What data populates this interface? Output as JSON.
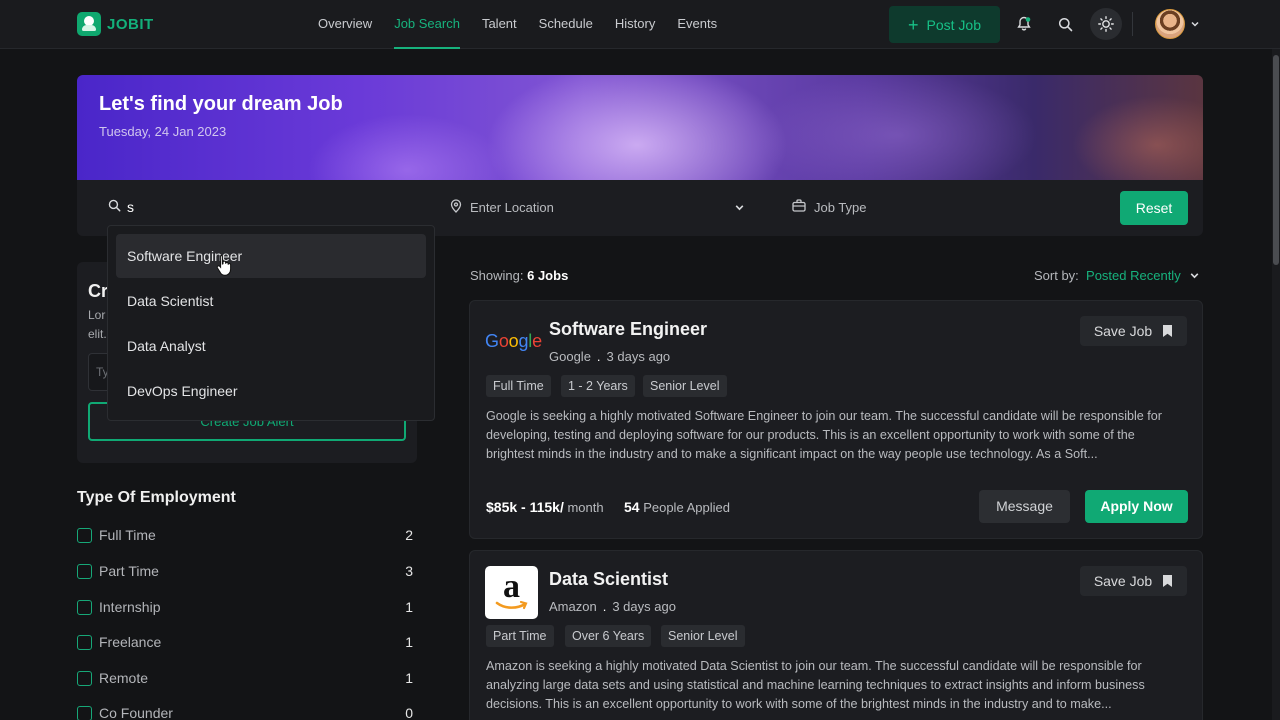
{
  "nav": {
    "logo": "JOBIT",
    "links": [
      "Overview",
      "Job Search",
      "Talent",
      "Schedule",
      "History",
      "Events"
    ],
    "active_link": "Job Search",
    "post_job": "Post Job"
  },
  "hero": {
    "title": "Let's find your dream Job",
    "date": "Tuesday, 24 Jan 2023"
  },
  "search": {
    "query": "s",
    "location_placeholder": "Enter Location",
    "job_type_placeholder": "Job Type",
    "reset": "Reset",
    "suggestions": [
      "Software Engineer",
      "Data Scientist",
      "Data Analyst",
      "DevOps Engineer"
    ],
    "hovered_suggestion": "Software Engineer"
  },
  "job_alert": {
    "title_visible": "Cr",
    "desc_line1": "Lor",
    "desc_line2": "elit.",
    "input_placeholder_visible": "Ty",
    "button": "Create Job Alert"
  },
  "employment": {
    "title": "Type Of Employment",
    "items": [
      {
        "label": "Full Time",
        "count": "2"
      },
      {
        "label": "Part Time",
        "count": "3"
      },
      {
        "label": "Internship",
        "count": "1"
      },
      {
        "label": "Freelance",
        "count": "1"
      },
      {
        "label": "Remote",
        "count": "1"
      },
      {
        "label": "Co Founder",
        "count": "0"
      }
    ]
  },
  "results": {
    "showing_label": "Showing:",
    "showing_value": "6 Jobs",
    "sort_label": "Sort by:",
    "sort_value": "Posted Recently"
  },
  "jobs": [
    {
      "title": "Software Engineer",
      "company": "Google",
      "posted": "3 days ago",
      "tags": [
        "Full Time",
        "1 - 2 Years",
        "Senior Level"
      ],
      "description": "Google is seeking a highly motivated Software Engineer to join our team. The successful candidate will be responsible for developing, testing and deploying software for our products. This is an excellent opportunity to work with some of the brightest minds in the industry and to make a significant impact on the way people use technology. As a Soft...",
      "salary": "$85k - 115k/",
      "salary_period": " month",
      "applied_count": "54",
      "applied_label": " People Applied",
      "save": "Save Job",
      "message": "Message",
      "apply": "Apply Now"
    },
    {
      "title": "Data Scientist",
      "company": "Amazon",
      "posted": "3 days ago",
      "tags": [
        "Part Time",
        "Over 6 Years",
        "Senior Level"
      ],
      "description": "Amazon is seeking a highly motivated Data Scientist to join our team. The successful candidate will be responsible for analyzing large data sets and using statistical and machine learning techniques to extract insights and inform business decisions. This is an excellent opportunity to work with some of the brightest minds in the industry and to make...",
      "save": "Save Job"
    }
  ],
  "colors": {
    "accent": "#10a974",
    "background": "#131416",
    "card": "#1c1d21"
  }
}
